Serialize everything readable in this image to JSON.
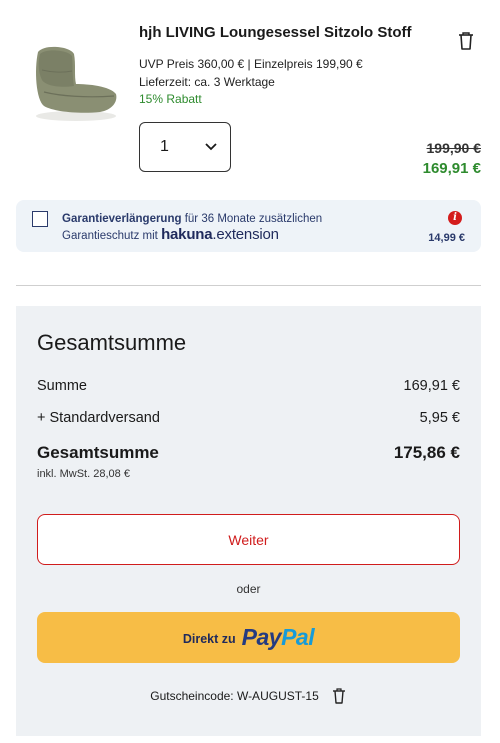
{
  "product": {
    "title": "hjh LIVING Loungesessel Sitzolo Stoff",
    "price_info": "UVP Preis  360,00 € | Einzelpreis  199,90 €",
    "delivery": "Lieferzeit:  ca. 3 Werktage",
    "discount": "15% Rabatt",
    "quantity": "1",
    "old_price": "199,90 €",
    "new_price": "169,91 €",
    "image_icon": "lounge-chair-thumbnail",
    "delete_icon": "trash-icon"
  },
  "warranty": {
    "title_bold": "Garantieverlängerung",
    "title_rest": " für 36 Monate zusätzlichen",
    "line2": "Garantieschutz mit",
    "brand_main": "hakuna",
    "brand_ext": ".extension",
    "info_icon": "i",
    "price": "14,99 €"
  },
  "summary": {
    "title": "Gesamtsumme",
    "subtotal_label": "Summe",
    "subtotal_value": "169,91 €",
    "shipping_label": "+ Standardversand",
    "shipping_value": "5,95 €",
    "total_label": "Gesamtsumme",
    "total_value": "175,86 €",
    "vat": "inkl. MwSt. 28,08 €",
    "continue_label": "Weiter",
    "or_label": "oder",
    "paypal_prefix": "Direkt zu",
    "paypal_pay": "Pay",
    "paypal_pal": "Pal",
    "coupon": "Gutscheincode: W-AUGUST-15"
  },
  "colors": {
    "accent_red": "#d01c1c",
    "green": "#2e8b2e",
    "paypal_yellow": "#f7bd46",
    "navy": "#2a3a6b"
  }
}
